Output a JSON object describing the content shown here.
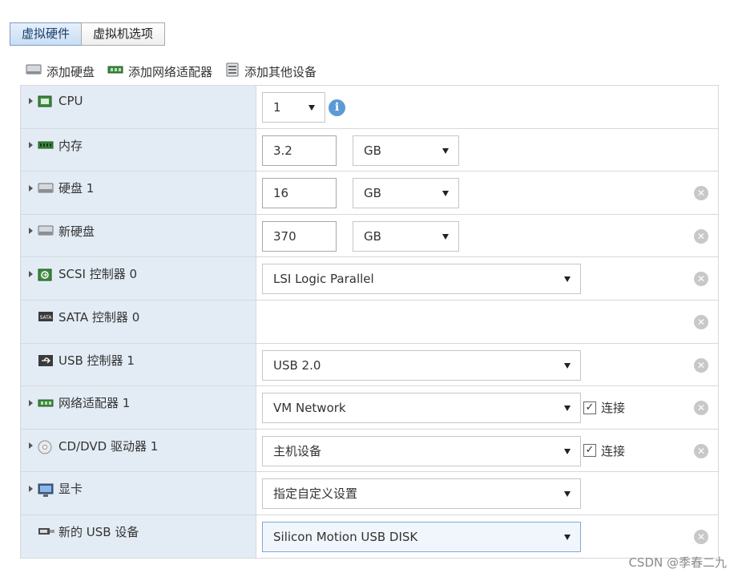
{
  "tabs": [
    {
      "label": "虚拟硬件",
      "active": true
    },
    {
      "label": "虚拟机选项",
      "active": false
    }
  ],
  "toolbar": {
    "add_disk": "添加硬盘",
    "add_network": "添加网络适配器",
    "add_other": "添加其他设备"
  },
  "rows": {
    "cpu": {
      "label": "CPU",
      "value": "1",
      "icon": "cpu-icon"
    },
    "memory": {
      "label": "内存",
      "value": "3.2",
      "unit": "GB",
      "icon": "memory-icon"
    },
    "disk1": {
      "label": "硬盘 1",
      "value": "16",
      "unit": "GB",
      "icon": "hard-disk-icon"
    },
    "new_disk": {
      "label": "新硬盘",
      "value": "370",
      "unit": "GB",
      "icon": "hard-disk-icon"
    },
    "scsi": {
      "label": "SCSI 控制器 0",
      "value": "LSI Logic Parallel",
      "icon": "scsi-controller-icon"
    },
    "sata": {
      "label": "SATA 控制器 0",
      "icon": "sata-controller-icon"
    },
    "usb_ctrl": {
      "label": "USB 控制器 1",
      "value": "USB 2.0",
      "icon": "usb-controller-icon"
    },
    "net": {
      "label": "网络适配器 1",
      "value": "VM Network",
      "connect": "连接",
      "connected": true,
      "icon": "network-adapter-icon"
    },
    "cd": {
      "label": "CD/DVD 驱动器 1",
      "value": "主机设备",
      "connect": "连接",
      "connected": true,
      "icon": "cd-dvd-icon"
    },
    "video": {
      "label": "显卡",
      "value": "指定自定义设置",
      "icon": "display-icon"
    },
    "usb_dev": {
      "label": "新的 USB 设备",
      "value": "Silicon Motion USB DISK",
      "icon": "usb-device-icon"
    }
  },
  "watermark": "CSDN @季春二九",
  "colors": {
    "label_bg": "#e3ecf5",
    "info_blue": "#5b9bd5",
    "remove_gray": "#c8c8c8"
  }
}
